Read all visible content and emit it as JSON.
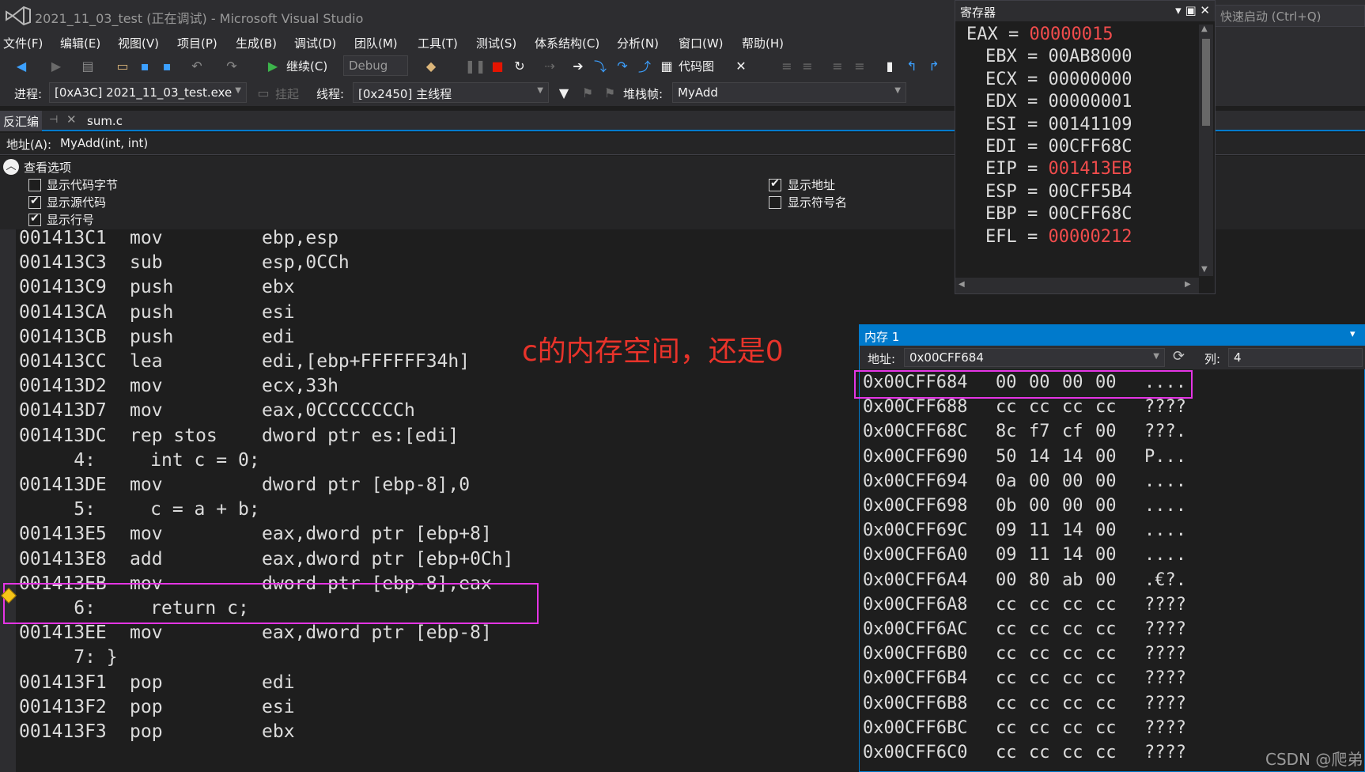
{
  "window": {
    "title": "2021_11_03_test (正在调试) - Microsoft Visual Studio",
    "quick_launch": "快速启动 (Ctrl+Q)"
  },
  "menu": [
    "文件(F)",
    "编辑(E)",
    "视图(V)",
    "项目(P)",
    "生成(B)",
    "调试(D)",
    "团队(M)",
    "工具(T)",
    "测试(S)",
    "体系结构(C)",
    "分析(N)",
    "窗口(W)",
    "帮助(H)"
  ],
  "toolbar": {
    "continue_label": "继续(C)",
    "config": "Debug",
    "code_map_label": "代码图"
  },
  "debug_location": {
    "process_label": "进程:",
    "process_value": "[0xA3C] 2021_11_03_test.exe",
    "suspend_label": "挂起",
    "thread_label": "线程:",
    "thread_value": "[0x2450] 主线程",
    "stackframe_label": "堆栈帧:",
    "stackframe_value": "MyAdd"
  },
  "tabs": {
    "disasm": "反汇编",
    "sum": "sum.c"
  },
  "address_bar": {
    "label": "地址(A):",
    "value": "MyAdd(int, int)"
  },
  "view_options": {
    "header": "查看选项",
    "options": [
      {
        "label": "显示代码字节",
        "checked": false
      },
      {
        "label": "显示源代码",
        "checked": true
      },
      {
        "label": "显示行号",
        "checked": true
      },
      {
        "label": "显示地址",
        "checked": true
      },
      {
        "label": "显示符号名",
        "checked": false
      }
    ]
  },
  "disassembly": [
    {
      "addr": "001413C1",
      "op": "mov",
      "arg": "ebp,esp"
    },
    {
      "addr": "001413C3",
      "op": "sub",
      "arg": "esp,0CCh"
    },
    {
      "addr": "001413C9",
      "op": "push",
      "arg": "ebx"
    },
    {
      "addr": "001413CA",
      "op": "push",
      "arg": "esi"
    },
    {
      "addr": "001413CB",
      "op": "push",
      "arg": "edi"
    },
    {
      "addr": "001413CC",
      "op": "lea",
      "arg": "edi,[ebp+FFFFFF34h]"
    },
    {
      "addr": "001413D2",
      "op": "mov",
      "arg": "ecx,33h"
    },
    {
      "addr": "001413D7",
      "op": "mov",
      "arg": "eax,0CCCCCCCCh"
    },
    {
      "addr": "001413DC",
      "op": "rep stos",
      "arg": "dword ptr es:[edi]"
    },
    {
      "src": "     4:     int c = 0;"
    },
    {
      "addr": "001413DE",
      "op": "mov",
      "arg": "dword ptr [ebp-8],0"
    },
    {
      "src": "     5:     c = a + b;"
    },
    {
      "addr": "001413E5",
      "op": "mov",
      "arg": "eax,dword ptr [ebp+8]"
    },
    {
      "addr": "001413E8",
      "op": "add",
      "arg": "eax,dword ptr [ebp+0Ch]"
    },
    {
      "addr": "001413EB",
      "op": "mov",
      "arg": "dword ptr [ebp-8],eax"
    },
    {
      "src": "     6:     return c;"
    },
    {
      "addr": "001413EE",
      "op": "mov",
      "arg": "eax,dword ptr [ebp-8]"
    },
    {
      "src": "     7: }"
    },
    {
      "addr": "001413F1",
      "op": "pop",
      "arg": "edi"
    },
    {
      "addr": "001413F2",
      "op": "pop",
      "arg": "esi"
    },
    {
      "addr": "001413F3",
      "op": "pop",
      "arg": "ebx"
    }
  ],
  "annotation": "c的内存空间，还是0",
  "registers": {
    "title": "寄存器",
    "items": [
      {
        "name": "EAX",
        "value": "00000015",
        "changed": true
      },
      {
        "name": "EBX",
        "value": "00AB8000",
        "changed": false
      },
      {
        "name": "ECX",
        "value": "00000000",
        "changed": false
      },
      {
        "name": "EDX",
        "value": "00000001",
        "changed": false
      },
      {
        "name": "ESI",
        "value": "00141109",
        "changed": false
      },
      {
        "name": "EDI",
        "value": "00CFF68C",
        "changed": false
      },
      {
        "name": "EIP",
        "value": "001413EB",
        "changed": true
      },
      {
        "name": "ESP",
        "value": "00CFF5B4",
        "changed": false
      },
      {
        "name": "EBP",
        "value": "00CFF68C",
        "changed": false
      },
      {
        "name": "EFL",
        "value": "00000212",
        "changed": true
      }
    ]
  },
  "memory": {
    "title": "内存 1",
    "addr_label": "地址:",
    "addr_value": "0x00CFF684",
    "col_label": "列:",
    "col_value": "4",
    "rows": [
      {
        "addr": "0x00CFF684",
        "bytes": [
          "00",
          "00",
          "00",
          "00"
        ],
        "ascii": "...."
      },
      {
        "addr": "0x00CFF688",
        "bytes": [
          "cc",
          "cc",
          "cc",
          "cc"
        ],
        "ascii": "????"
      },
      {
        "addr": "0x00CFF68C",
        "bytes": [
          "8c",
          "f7",
          "cf",
          "00"
        ],
        "ascii": "???."
      },
      {
        "addr": "0x00CFF690",
        "bytes": [
          "50",
          "14",
          "14",
          "00"
        ],
        "ascii": "P..."
      },
      {
        "addr": "0x00CFF694",
        "bytes": [
          "0a",
          "00",
          "00",
          "00"
        ],
        "ascii": "...."
      },
      {
        "addr": "0x00CFF698",
        "bytes": [
          "0b",
          "00",
          "00",
          "00"
        ],
        "ascii": "...."
      },
      {
        "addr": "0x00CFF69C",
        "bytes": [
          "09",
          "11",
          "14",
          "00"
        ],
        "ascii": "...."
      },
      {
        "addr": "0x00CFF6A0",
        "bytes": [
          "09",
          "11",
          "14",
          "00"
        ],
        "ascii": "...."
      },
      {
        "addr": "0x00CFF6A4",
        "bytes": [
          "00",
          "80",
          "ab",
          "00"
        ],
        "ascii": ".€?."
      },
      {
        "addr": "0x00CFF6A8",
        "bytes": [
          "cc",
          "cc",
          "cc",
          "cc"
        ],
        "ascii": "????"
      },
      {
        "addr": "0x00CFF6AC",
        "bytes": [
          "cc",
          "cc",
          "cc",
          "cc"
        ],
        "ascii": "????"
      },
      {
        "addr": "0x00CFF6B0",
        "bytes": [
          "cc",
          "cc",
          "cc",
          "cc"
        ],
        "ascii": "????"
      },
      {
        "addr": "0x00CFF6B4",
        "bytes": [
          "cc",
          "cc",
          "cc",
          "cc"
        ],
        "ascii": "????"
      },
      {
        "addr": "0x00CFF6B8",
        "bytes": [
          "cc",
          "cc",
          "cc",
          "cc"
        ],
        "ascii": "????"
      },
      {
        "addr": "0x00CFF6BC",
        "bytes": [
          "cc",
          "cc",
          "cc",
          "cc"
        ],
        "ascii": "????"
      },
      {
        "addr": "0x00CFF6C0",
        "bytes": [
          "cc",
          "cc",
          "cc",
          "cc"
        ],
        "ascii": "????"
      }
    ]
  },
  "watermark": "CSDN @爬弟",
  "colors": {
    "accent": "#007acc",
    "changed_value": "#f14c4c",
    "annotation": "#e8332a",
    "highlight_box": "#e535e5"
  }
}
